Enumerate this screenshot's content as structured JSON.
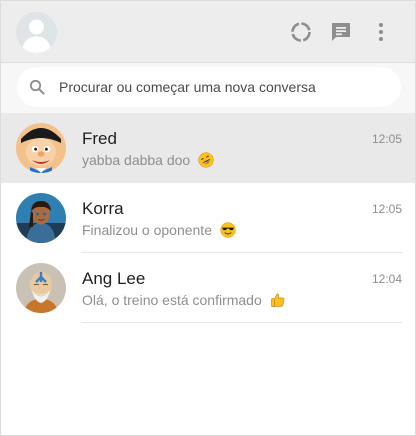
{
  "header": {
    "profile_avatar": "default-user-avatar",
    "icons": [
      "status-icon",
      "new-chat-icon",
      "menu-icon"
    ]
  },
  "search": {
    "placeholder": "Procurar ou começar uma nova conversa",
    "value": ""
  },
  "chats": [
    {
      "name": "Fred",
      "time": "12:05",
      "message": "yabba dabba doo",
      "emoji": "rofl-emoji",
      "active": true
    },
    {
      "name": "Korra",
      "time": "12:05",
      "message": "Finalizou o oponente",
      "emoji": "sunglasses-emoji",
      "active": false
    },
    {
      "name": "Ang Lee",
      "time": "12:04",
      "message": "Olá, o treino está confirmado",
      "emoji": "thumbs-up-emoji",
      "active": false
    }
  ],
  "colors": {
    "header_bg": "#ededed",
    "search_bg": "#f7f7f7",
    "active_row_bg": "#e9e9e9",
    "icon_gray": "#8e8e8e"
  }
}
